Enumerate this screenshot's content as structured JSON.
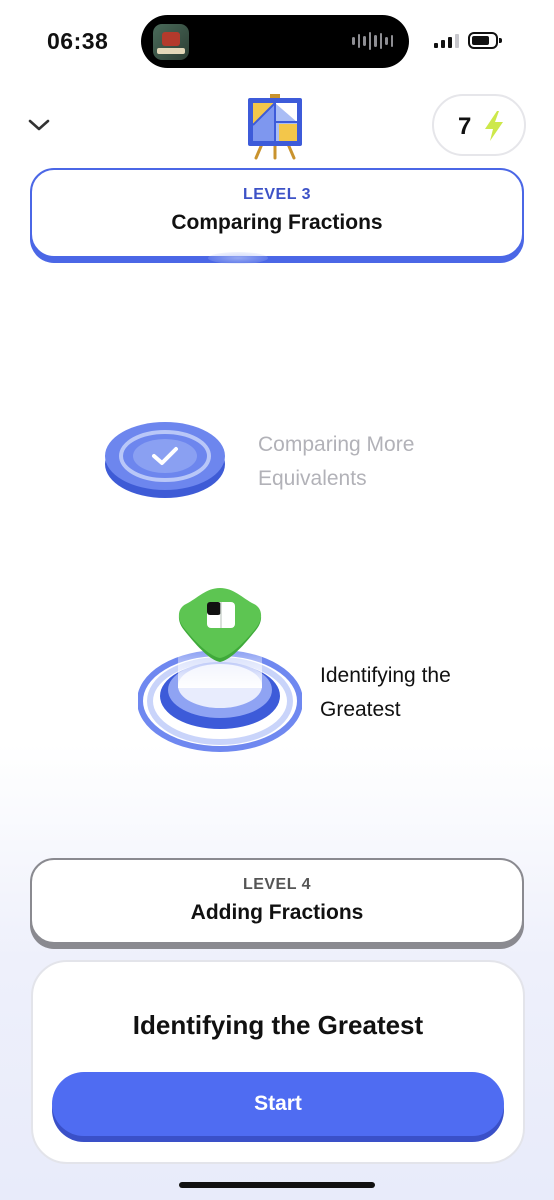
{
  "status_bar": {
    "time": "06:38",
    "island_app_icon": "game-app-icon",
    "waveform_icon": "audio-waveform-icon",
    "signal_icon": "cellular-signal-icon",
    "battery_icon": "battery-icon"
  },
  "header": {
    "collapse_icon": "chevron-down-icon",
    "course_icon": "easel-art-icon",
    "energy": {
      "count": "7",
      "icon": "lightning-bolt-icon",
      "color": "#cde84a"
    }
  },
  "levels": [
    {
      "label": "LEVEL 3",
      "title": "Comparing Fractions",
      "state": "current",
      "border_color": "#4b67e6"
    },
    {
      "label": "LEVEL 4",
      "title": "Adding Fractions",
      "state": "locked",
      "border_color": "#8a8a90"
    }
  ],
  "lessons": [
    {
      "title": "Comparing More Equivalents",
      "status": "completed",
      "icon": "checkmark-icon"
    },
    {
      "title": "Identifying the Greatest",
      "status": "active",
      "icon": "fraction-square-badge-icon"
    }
  ],
  "bottom_sheet": {
    "title": "Identifying the Greatest",
    "start_label": "Start",
    "accent": "#4f6cf2"
  }
}
